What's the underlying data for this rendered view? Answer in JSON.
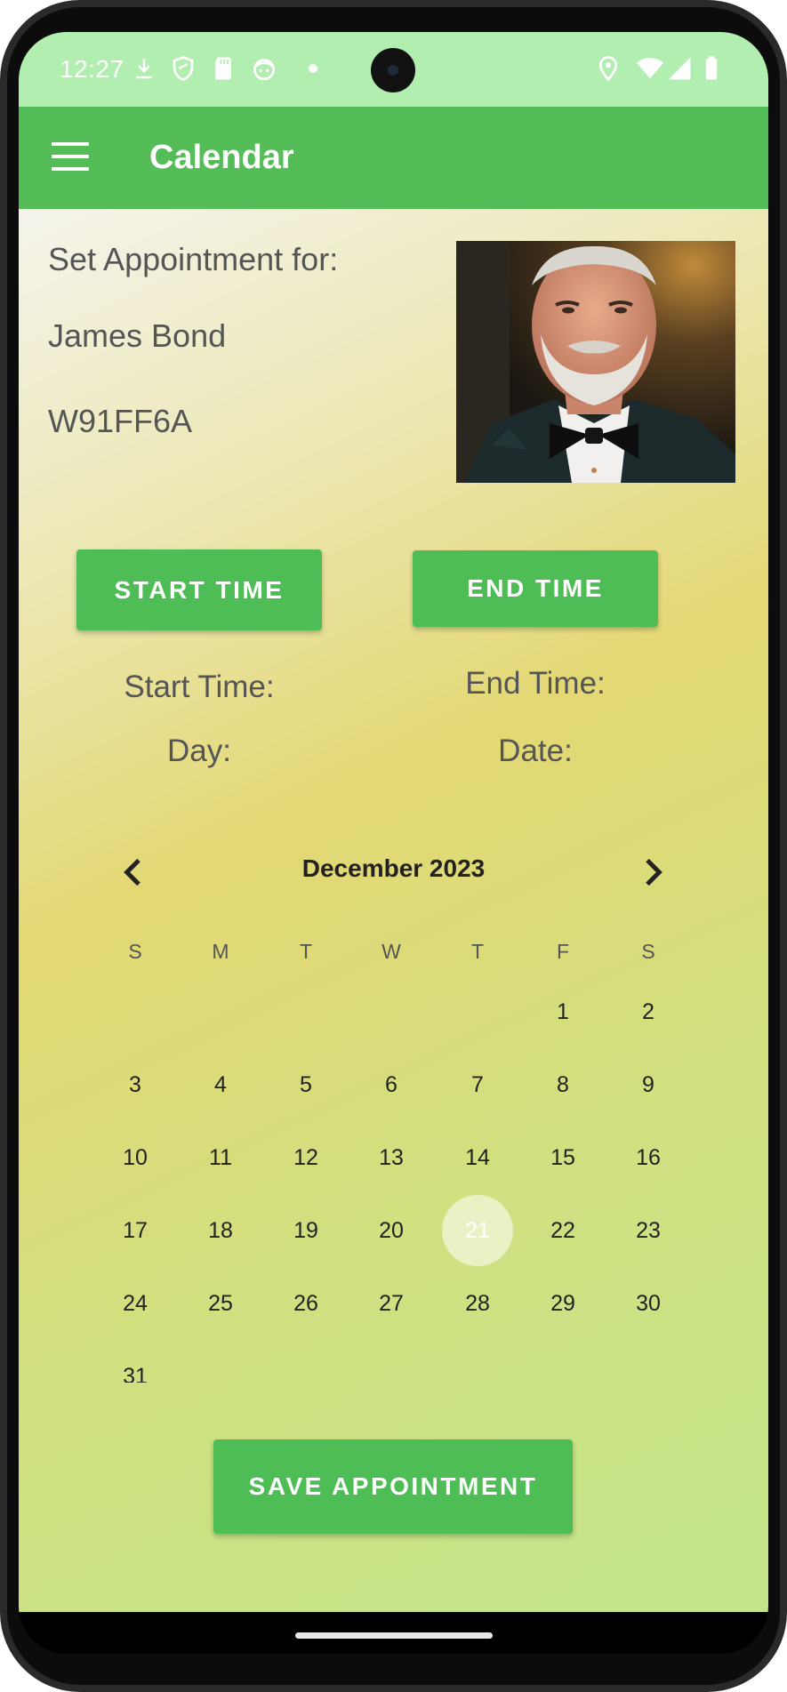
{
  "status_bar": {
    "time": "12:27",
    "left_icons": [
      "download-icon",
      "shield-icon",
      "sd-card-icon",
      "face-icon",
      "dot-icon"
    ],
    "right_icons": [
      "location-icon",
      "wifi-icon",
      "signal-icon",
      "battery-icon"
    ]
  },
  "app_bar": {
    "title": "Calendar",
    "menu_icon": "hamburger-menu-icon",
    "color": "#54bd57"
  },
  "appointment": {
    "heading": "Set Appointment for:",
    "name": "James Bond",
    "code": "W91FF6A"
  },
  "buttons": {
    "start_time": "START TIME",
    "end_time": "END TIME",
    "save": "SAVE APPOINTMENT"
  },
  "labels": {
    "start_time": "Start Time:",
    "end_time": "End Time:",
    "day": "Day:",
    "date": "Date:"
  },
  "calendar": {
    "month_label": "December 2023",
    "prev_icon": "chevron-left-icon",
    "next_icon": "chevron-right-icon",
    "weekdays": [
      "S",
      "M",
      "T",
      "W",
      "T",
      "F",
      "S"
    ],
    "first_weekday_index": 5,
    "days_in_month": 31,
    "selected_day": 21
  },
  "colors": {
    "accent_green": "#4fbd55",
    "status_bar": "#b1eeb0"
  }
}
